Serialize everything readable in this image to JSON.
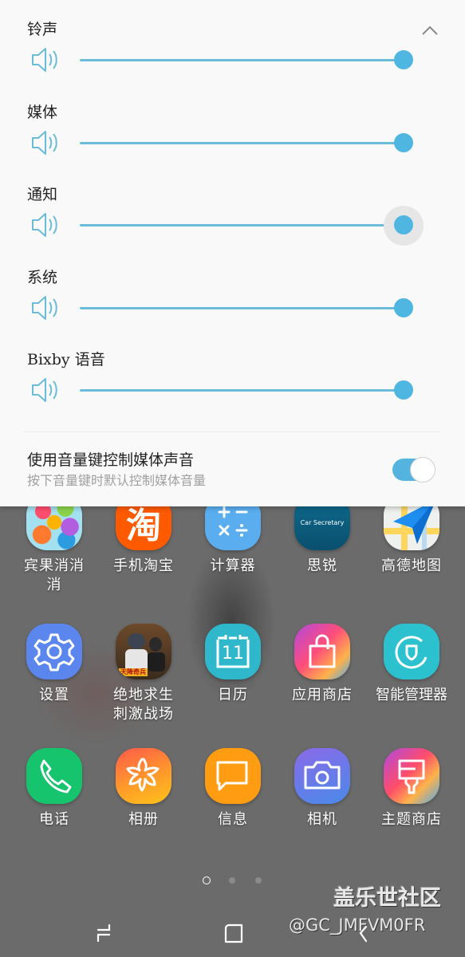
{
  "volume_panel": {
    "collapse_icon": "chevron-up-icon",
    "sliders": [
      {
        "label": "铃声",
        "icon": "speaker-icon",
        "level_percent": 100,
        "active": false
      },
      {
        "label": "媒体",
        "icon": "speaker-icon",
        "level_percent": 100,
        "active": false
      },
      {
        "label": "通知",
        "icon": "speaker-icon",
        "level_percent": 100,
        "active": true
      },
      {
        "label": "系统",
        "icon": "speaker-icon",
        "level_percent": 100,
        "active": false
      },
      {
        "label": "Bixby 语音",
        "icon": "speaker-icon",
        "level_percent": 100,
        "active": false
      }
    ],
    "media_key_toggle": {
      "title": "使用音量键控制媒体声音",
      "subtitle": "按下音量键时默认控制媒体音量",
      "enabled": true
    },
    "accent_color": "#4fb6e2"
  },
  "home_screen": {
    "rows": [
      [
        {
          "label": "宾果消消消",
          "icon": "candy-game-icon"
        },
        {
          "label": "手机淘宝",
          "icon": "taobao-icon",
          "glyph": "淘"
        },
        {
          "label": "计算器",
          "icon": "calculator-icon"
        },
        {
          "label": "思锐",
          "icon": "car-secretary-icon",
          "glyph": "Car Secretary"
        },
        {
          "label": "高德地图",
          "icon": "amap-icon"
        }
      ],
      [
        {
          "label": "设置",
          "icon": "settings-gear-icon"
        },
        {
          "label": "绝地求生刺激战场",
          "icon": "pubg-game-icon",
          "glyph": "天降奇兵"
        },
        {
          "label": "日历",
          "icon": "calendar-icon",
          "glyph": "11"
        },
        {
          "label": "应用商店",
          "icon": "app-store-bag-icon"
        },
        {
          "label": "智能管理器",
          "icon": "device-care-icon"
        }
      ],
      [
        {
          "label": "电话",
          "icon": "phone-icon"
        },
        {
          "label": "相册",
          "icon": "gallery-flower-icon"
        },
        {
          "label": "信息",
          "icon": "messages-icon"
        },
        {
          "label": "相机",
          "icon": "camera-icon"
        },
        {
          "label": "主题商店",
          "icon": "theme-store-brush-icon"
        }
      ]
    ],
    "page_indicator": {
      "pages": 3,
      "current": 1
    }
  },
  "nav_bar": {
    "recent_icon": "recent-apps-icon",
    "home_icon": "home-icon",
    "back_icon": "back-icon"
  },
  "watermark": {
    "title": "盖乐世社区",
    "handle": "@GC_JMFVM0FR"
  }
}
